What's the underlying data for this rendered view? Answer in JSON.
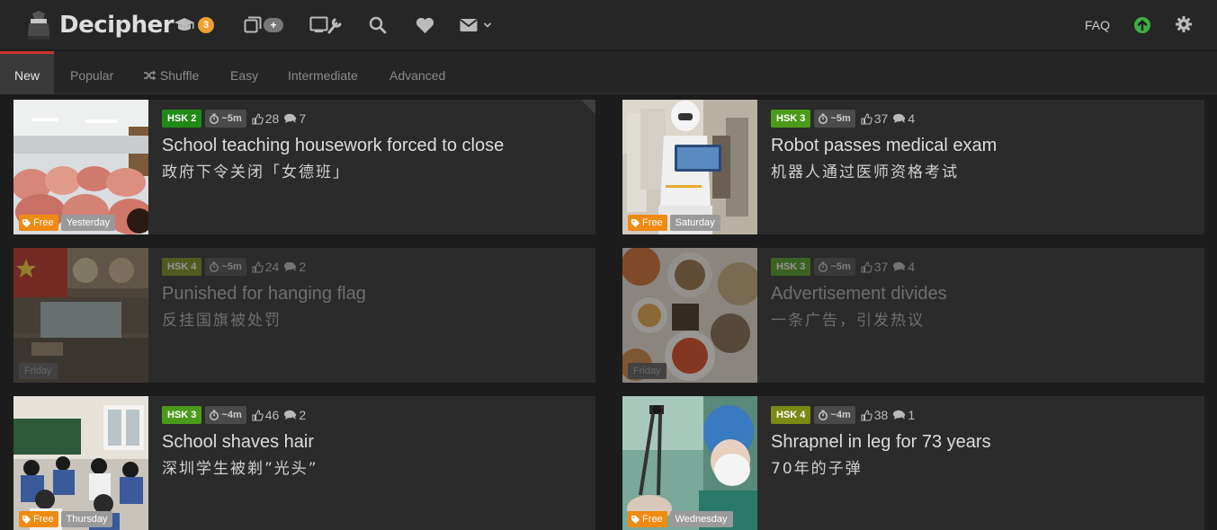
{
  "header": {
    "logo_text": "Decipher",
    "courses_badge": "3",
    "flashcards_badge": "+",
    "faq_label": "FAQ"
  },
  "tabs": [
    {
      "label": "New",
      "active": true
    },
    {
      "label": "Popular"
    },
    {
      "label": "Shuffle",
      "icon": "shuffle-icon"
    },
    {
      "label": "Easy"
    },
    {
      "label": "Intermediate"
    },
    {
      "label": "Advanced"
    }
  ],
  "colors": {
    "hsk_2": "#1f8a17",
    "hsk_3": "#4c9a1a",
    "hsk_4": "#7a8a14",
    "free_tag": "#f08a12",
    "accent_red": "#cc3333",
    "upload_green": "#3cb043"
  },
  "articles": [
    {
      "hsk": "HSK 2",
      "time": "~5m",
      "likes": "28",
      "comments": "7",
      "title": "School teaching housework forced to close",
      "subtitle": "政府下令关闭「女德班」",
      "free_label": "Free",
      "day": "Yesterday",
      "dim": false
    },
    {
      "hsk": "HSK 3",
      "time": "~5m",
      "likes": "37",
      "comments": "4",
      "title": "Robot passes medical exam",
      "subtitle": "机器人通过医师资格考试",
      "free_label": "Free",
      "day": "Saturday",
      "dim": false
    },
    {
      "hsk": "HSK 4",
      "time": "~5m",
      "likes": "24",
      "comments": "2",
      "title": "Punished for hanging flag",
      "subtitle": "反挂国旗被处罚",
      "free_label": "",
      "day": "Friday",
      "dim": true
    },
    {
      "hsk": "HSK 3",
      "time": "~5m",
      "likes": "37",
      "comments": "4",
      "title": "Advertisement divides",
      "subtitle": "一条广告，引发热议",
      "free_label": "",
      "day": "Friday",
      "dim": true
    },
    {
      "hsk": "HSK 3",
      "time": "~4m",
      "likes": "46",
      "comments": "2",
      "title": "School shaves hair",
      "subtitle": "深圳学生被剃”光头”",
      "free_label": "Free",
      "day": "Thursday",
      "dim": false
    },
    {
      "hsk": "HSK 4",
      "time": "~4m",
      "likes": "38",
      "comments": "1",
      "title": "Shrapnel in leg for 73 years",
      "subtitle": "70年的子弹",
      "free_label": "Free",
      "day": "Wednesday",
      "dim": false
    }
  ]
}
